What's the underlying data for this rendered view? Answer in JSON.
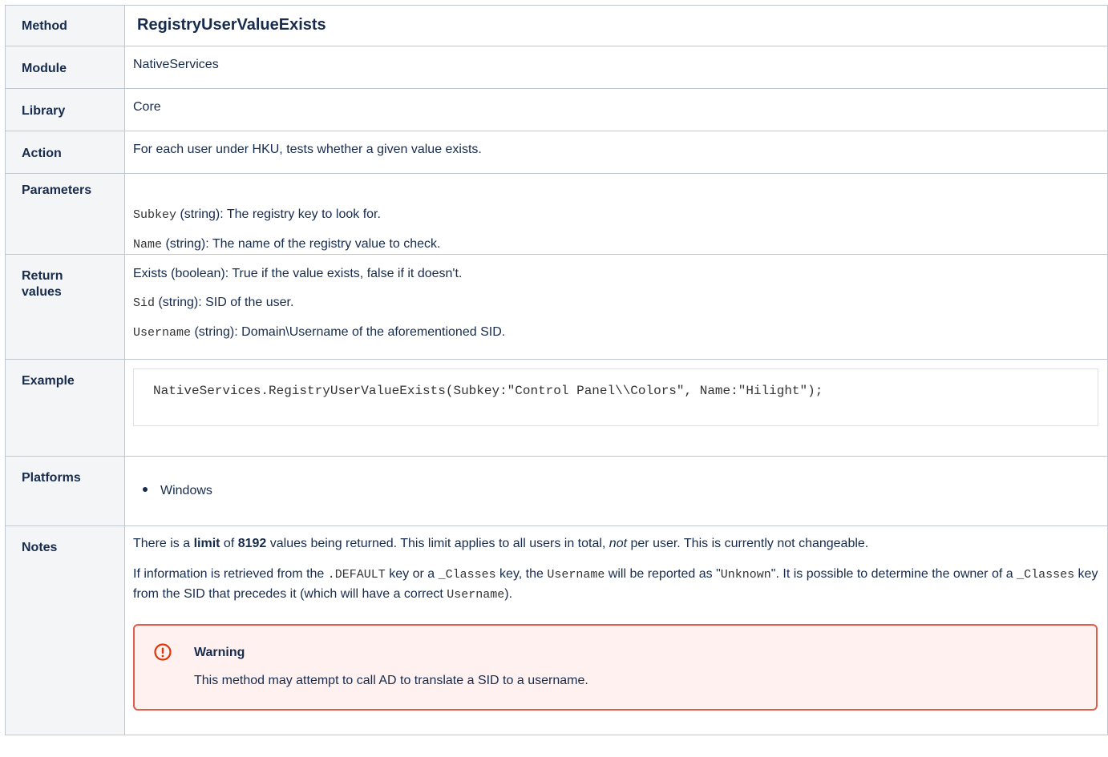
{
  "method": {
    "label": "Method",
    "value": "RegistryUserValueExists"
  },
  "module": {
    "label": "Module",
    "value": "NativeServices"
  },
  "library": {
    "label": "Library",
    "value": "Core"
  },
  "action": {
    "label": "Action",
    "value": "For each user under HKU, tests whether a given value exists."
  },
  "parameters": {
    "label": "Parameters",
    "items": [
      {
        "code": "Subkey",
        "text": " (string): The registry key to look for."
      },
      {
        "code": "Name",
        "text": " (string): The name of the registry value to check."
      }
    ]
  },
  "return_values": {
    "label_line1": "Return",
    "label_line2": "values",
    "line1": "Exists (boolean): True if the value exists, false if it doesn't.",
    "items": [
      {
        "code": "Sid",
        "text": " (string): SID of the user."
      },
      {
        "code": "Username",
        "text": " (string): Domain\\Username of the aforementioned SID."
      }
    ]
  },
  "example": {
    "label": "Example",
    "code": "NativeServices.RegistryUserValueExists(Subkey:\"Control Panel\\\\Colors\", Name:\"Hilight\");"
  },
  "platforms": {
    "label": "Platforms",
    "items": [
      "Windows"
    ]
  },
  "notes": {
    "label": "Notes",
    "p1": {
      "t1": "There is a ",
      "b1": "limit",
      "t2": " of ",
      "b2": "8192",
      "t3": " values being returned. This limit applies to all users in total, ",
      "i1": "not",
      "t4": " per user. This is currently not changeable."
    },
    "p2": {
      "t1": "If information is retrieved from the ",
      "c1": ".DEFAULT",
      "t2": " key or a ",
      "c2": "_Classes",
      "t3": " key, the ",
      "c3": "Username",
      "t4": " will be reported as \"",
      "c4": "Unknown",
      "t5": "\". It is possible to determine the owner of a ",
      "c5": "_Classes",
      "t6": " key from the SID that precedes it (which will have a correct ",
      "c6": "Username",
      "t7": ")."
    },
    "warning": {
      "title": "Warning",
      "body": "This method may attempt to call AD to translate a SID to a username.",
      "icon": "exclamation-circle-icon",
      "color": "#de350b"
    }
  }
}
